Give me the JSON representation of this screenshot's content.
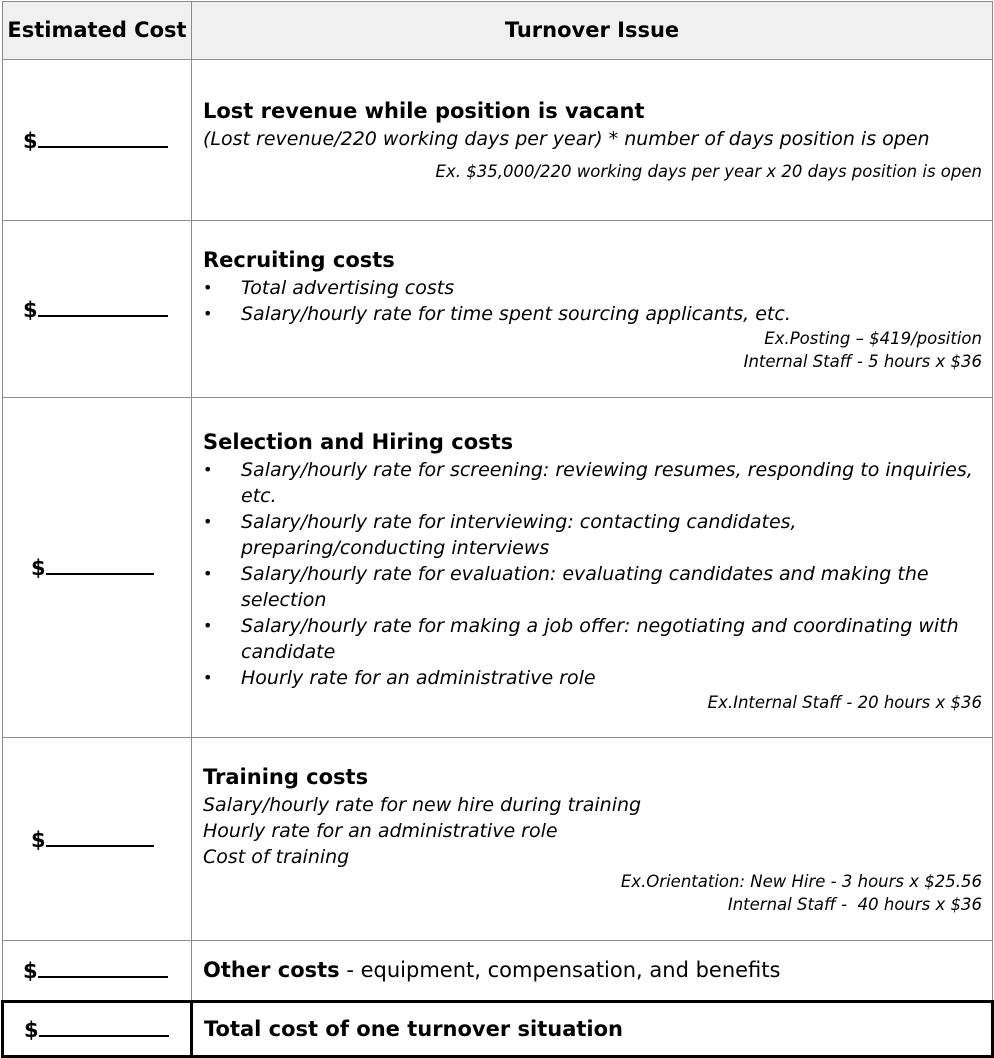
{
  "header": {
    "col1": "Estimated Cost",
    "col2": "Turnover Issue"
  },
  "rows": [
    {
      "cost_prefix": "$",
      "title": "Lost revenue while position is vacant",
      "description": "(Lost revenue/220 working days per year) * number of days position is open",
      "examples": [
        "Ex. $35,000/220 working days per year x 20 days position is open"
      ]
    },
    {
      "cost_prefix": "$",
      "title": "Recruiting costs",
      "bullets": [
        "Total advertising costs",
        "Salary/hourly rate for time spent sourcing applicants, etc."
      ],
      "examples": [
        "Ex.Posting – $419/position",
        "Internal Staff - 5 hours x $36"
      ]
    },
    {
      "cost_prefix": "$",
      "title": "Selection and Hiring costs",
      "bullets": [
        "Salary/hourly rate for screening: reviewing resumes, responding to inquiries, etc.",
        "Salary/hourly rate for interviewing: contacting candidates, preparing/conducting interviews",
        "Salary/hourly rate for evaluation: evaluating candidates and making the selection",
        "Salary/hourly rate for making a job offer: negotiating and coordinating with candidate",
        "Hourly rate for an administrative role"
      ],
      "examples": [
        "Ex.Internal Staff - 20 hours x $36"
      ]
    },
    {
      "cost_prefix": "$",
      "title": "Training costs",
      "lines": [
        "Salary/hourly rate for new hire during training",
        "Hourly rate for an administrative role",
        "Cost of training"
      ],
      "examples": [
        "Ex.Orientation: New Hire - 3 hours x $25.56",
        "Internal Staff -  40 hours x $36"
      ]
    },
    {
      "cost_prefix": "$",
      "title": "Other costs",
      "rest": " - equipment, compensation, and benefits"
    },
    {
      "cost_prefix": "$",
      "title": "Total cost of one turnover situation"
    }
  ]
}
